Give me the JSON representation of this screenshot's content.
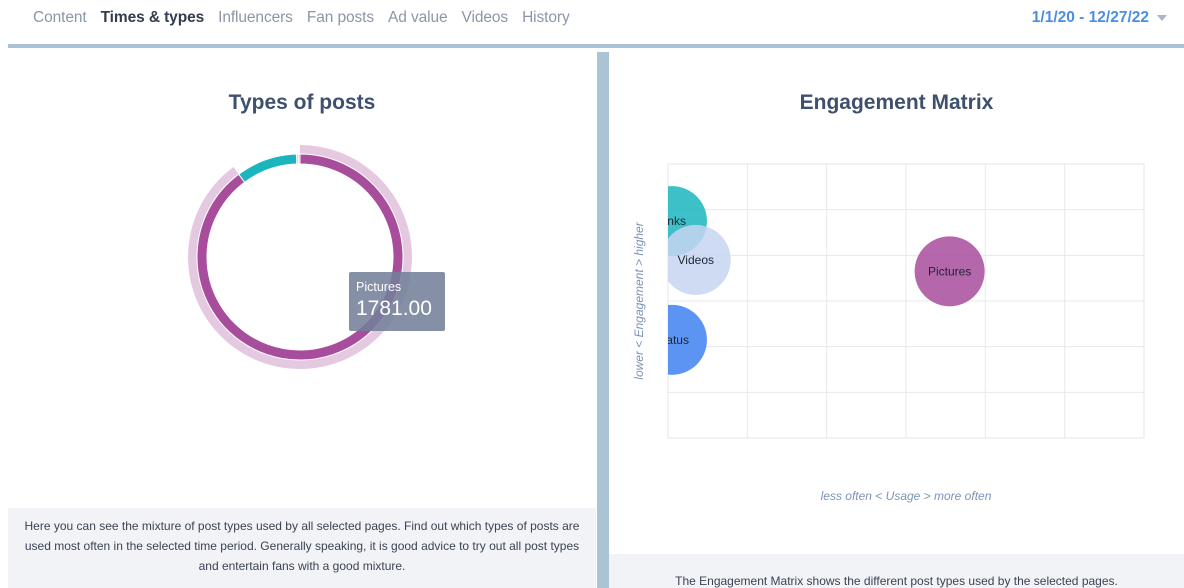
{
  "nav": {
    "tabs": [
      {
        "label": "Content",
        "active": false
      },
      {
        "label": "Times & types",
        "active": true
      },
      {
        "label": "Influencers",
        "active": false
      },
      {
        "label": "Fan posts",
        "active": false
      },
      {
        "label": "Ad value",
        "active": false
      },
      {
        "label": "Videos",
        "active": false
      },
      {
        "label": "History",
        "active": false
      }
    ],
    "date_range": "1/1/20 - 12/27/22",
    "dropdown_icon": "chevron-down-icon"
  },
  "types_of_posts": {
    "title": "Types of posts",
    "tooltip": {
      "label": "Pictures",
      "value": "1781.00"
    },
    "description": "Here you can see the mixture of post types used by all selected pages. Find out which types of posts are used most often in the selected time period. Generally speaking, it is good advice to try out all post types and entertain fans with a good mixture."
  },
  "engagement_matrix": {
    "title": "Engagement Matrix",
    "description": "The Engagement Matrix shows the different post types used by the selected pages."
  },
  "colors": {
    "pictures": "#a84c9c",
    "links": "#1bb5be",
    "videos": "#c7d5f1",
    "status": "#4a88f3",
    "accent": "#4a8ee4"
  },
  "chart_data": [
    {
      "type": "pie",
      "variant": "donut",
      "series": [
        {
          "name": "Pictures",
          "value": 1781.0,
          "color": "#a84c9c"
        },
        {
          "name": "Links",
          "value": 190,
          "color": "#1bb5be"
        },
        {
          "name": "Videos",
          "value": 7,
          "color": "#c7d5f1"
        },
        {
          "name": "Status",
          "value": 4,
          "color": "#4a88f3"
        }
      ],
      "title": "Types of posts",
      "highlighted": "Pictures",
      "legend": "none"
    },
    {
      "type": "scatter",
      "variant": "bubble",
      "title": "Engagement Matrix",
      "xlabel": "less often < Usage > more often",
      "ylabel": "lower < Engagement > higher",
      "xlim": [
        0,
        6
      ],
      "ylim": [
        0,
        6
      ],
      "grid": true,
      "points": [
        {
          "name": "Links",
          "label": "Links",
          "x": 0.05,
          "y": 4.75,
          "color": "#1bb5be",
          "opacity": 0.85
        },
        {
          "name": "Videos",
          "label": "Videos",
          "x": 0.35,
          "y": 3.9,
          "color": "#c7d5f1",
          "opacity": 0.85
        },
        {
          "name": "Pictures",
          "label": "Pictures",
          "x": 3.55,
          "y": 3.65,
          "color": "#a84c9c",
          "opacity": 0.85
        },
        {
          "name": "Status",
          "label": "Status",
          "x": 0.05,
          "y": 2.15,
          "color": "#4a88f3",
          "opacity": 0.9
        }
      ]
    }
  ]
}
